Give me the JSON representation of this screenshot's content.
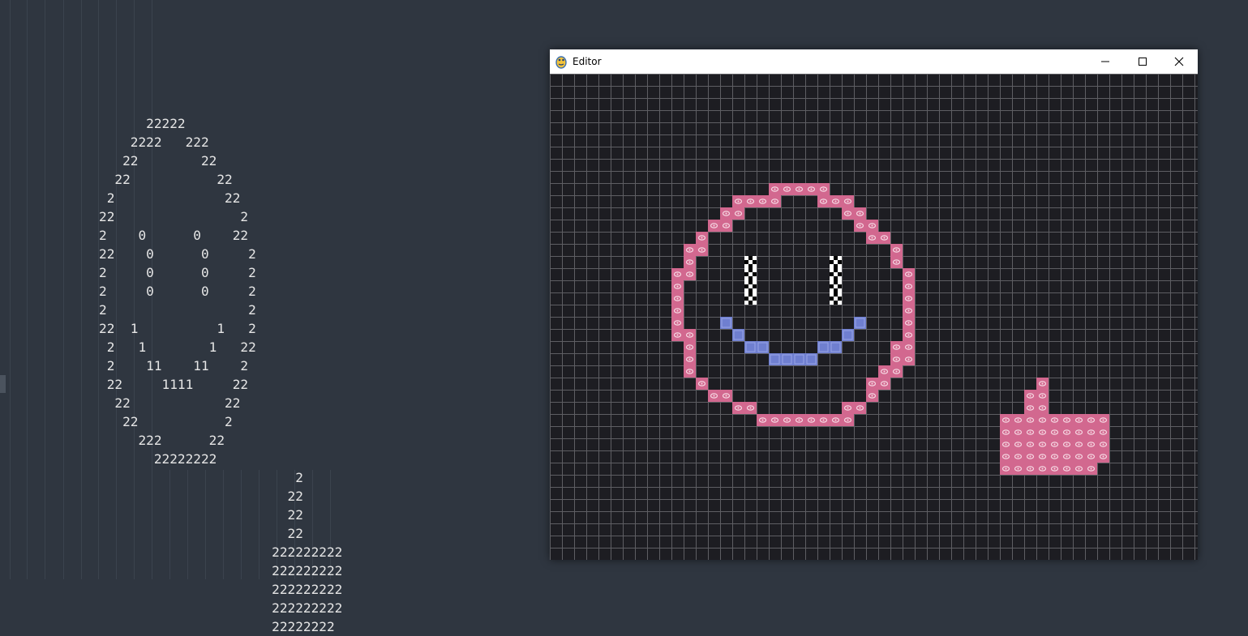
{
  "editor": {
    "lines": [
      "      22222",
      "    2222   222",
      "   22        22",
      "  22           22",
      " 2              22",
      "22                2",
      "2    0      0    22",
      "22    0      0     2",
      "2     0      0     2",
      "2     0      0     2",
      "2                  2",
      "22  1          1   2",
      " 2   1        1   22",
      " 2    11    11    2",
      " 22     1111     22",
      "  22            22",
      "   22           2",
      "     222      22",
      "       22222222",
      "                         2",
      "                        22",
      "                        22",
      "                        22",
      "                      222222222",
      "                      222222222",
      "                      222222222",
      "                      222222222",
      "                      22222222"
    ],
    "line_offsets_chars": [
      5,
      4,
      3,
      2,
      1,
      1,
      1,
      0,
      0,
      0,
      0,
      0,
      1,
      1,
      1,
      2,
      3,
      4,
      6,
      0,
      0,
      0,
      0,
      0,
      0,
      0,
      0,
      0
    ]
  },
  "window": {
    "title": "Editor",
    "icon": "pygame-snake-icon",
    "controls": [
      "minimize-icon",
      "maximize-icon",
      "close-icon"
    ]
  },
  "grid": {
    "cols": 53,
    "rows": 40,
    "background": "#1d1d22",
    "line_color": "#5e5e63",
    "tiles": {
      "2": {
        "name": "pink-chain-tile",
        "fill": "#d2688f",
        "detail": "#f6d8e3"
      },
      "1": {
        "name": "blue-tile",
        "fill": "#6f7fd0",
        "detail": "#9aa6e6"
      },
      "0": {
        "name": "checker-tile",
        "fill": "#000000",
        "detail": "#ffffff"
      }
    },
    "rows_data": [
      "",
      "",
      "",
      "",
      "",
      "",
      "",
      "",
      "",
      "                   ====",
      "               ====    ===",
      "              ==          ==",
      "             ==             ==",
      "            =                ==",
      "           ==                  =",
      "           =                   =",
      "          ==                    =",
      "          =     0      0        =",
      "          ==    0      0        =",
      "          ==    0      0        =",
      "          ==    0      0        =",
      "          ==                    =",
      "          ==                   ==",
      "          ==  1          1    ==",
      "           =   1        1     ==",
      "           =    11    11     ==",
      "           =      1111       ==",
      "            ==               =",
      "             ==            ==",
      "               ==        ==",
      "                 ========",
      "",
      "",
      "",
      "",
      "",
      "",
      "",
      "",
      ""
    ],
    "cells": [
      [
        9,
        18
      ],
      [
        9,
        19
      ],
      [
        9,
        20
      ],
      [
        9,
        21
      ],
      [
        9,
        22
      ],
      [
        10,
        15
      ],
      [
        10,
        16
      ],
      [
        10,
        17
      ],
      [
        10,
        18
      ],
      [
        10,
        22
      ],
      [
        10,
        23
      ],
      [
        10,
        24
      ],
      [
        11,
        14
      ],
      [
        11,
        15
      ],
      [
        11,
        24
      ],
      [
        11,
        25
      ],
      [
        12,
        13
      ],
      [
        12,
        14
      ],
      [
        12,
        25
      ],
      [
        12,
        26
      ],
      [
        13,
        12
      ],
      [
        13,
        26
      ],
      [
        13,
        27
      ],
      [
        14,
        11
      ],
      [
        14,
        12
      ],
      [
        14,
        28
      ],
      [
        15,
        11
      ],
      [
        15,
        28
      ],
      [
        16,
        10
      ],
      [
        16,
        11
      ],
      [
        16,
        29
      ],
      [
        17,
        10
      ],
      [
        17,
        29
      ],
      [
        18,
        10
      ],
      [
        18,
        29
      ],
      [
        19,
        10
      ],
      [
        19,
        29
      ],
      [
        20,
        10
      ],
      [
        20,
        29
      ],
      [
        21,
        10
      ],
      [
        21,
        11
      ],
      [
        21,
        29
      ],
      [
        22,
        11
      ],
      [
        22,
        28
      ],
      [
        22,
        29
      ],
      [
        23,
        11
      ],
      [
        23,
        28
      ],
      [
        23,
        29
      ],
      [
        24,
        11
      ],
      [
        24,
        27
      ],
      [
        24,
        28
      ],
      [
        25,
        12
      ],
      [
        25,
        26
      ],
      [
        25,
        27
      ],
      [
        26,
        13
      ],
      [
        26,
        14
      ],
      [
        26,
        26
      ],
      [
        27,
        15
      ],
      [
        27,
        16
      ],
      [
        27,
        24
      ],
      [
        27,
        25
      ],
      [
        28,
        17
      ],
      [
        28,
        18
      ],
      [
        28,
        19
      ],
      [
        28,
        20
      ],
      [
        28,
        21
      ],
      [
        28,
        22
      ],
      [
        28,
        23
      ],
      [
        28,
        24
      ],
      [
        25,
        40
      ],
      [
        26,
        39
      ],
      [
        26,
        40
      ],
      [
        27,
        39
      ],
      [
        27,
        40
      ],
      [
        28,
        37
      ],
      [
        28,
        38
      ],
      [
        28,
        39
      ],
      [
        28,
        40
      ],
      [
        28,
        41
      ],
      [
        28,
        42
      ],
      [
        28,
        43
      ],
      [
        28,
        44
      ],
      [
        28,
        45
      ],
      [
        29,
        37
      ],
      [
        29,
        38
      ],
      [
        29,
        39
      ],
      [
        29,
        40
      ],
      [
        29,
        41
      ],
      [
        29,
        42
      ],
      [
        29,
        43
      ],
      [
        29,
        44
      ],
      [
        29,
        45
      ],
      [
        30,
        37
      ],
      [
        30,
        38
      ],
      [
        30,
        39
      ],
      [
        30,
        40
      ],
      [
        30,
        41
      ],
      [
        30,
        42
      ],
      [
        30,
        43
      ],
      [
        30,
        44
      ],
      [
        30,
        45
      ],
      [
        31,
        37
      ],
      [
        31,
        38
      ],
      [
        31,
        39
      ],
      [
        31,
        40
      ],
      [
        31,
        41
      ],
      [
        31,
        42
      ],
      [
        31,
        43
      ],
      [
        31,
        44
      ],
      [
        31,
        45
      ],
      [
        32,
        37
      ],
      [
        32,
        38
      ],
      [
        32,
        39
      ],
      [
        32,
        40
      ],
      [
        32,
        41
      ],
      [
        32,
        42
      ],
      [
        32,
        43
      ],
      [
        32,
        44
      ]
    ],
    "eye_cells": [
      [
        15,
        16
      ],
      [
        16,
        16
      ],
      [
        17,
        16
      ],
      [
        18,
        16
      ],
      [
        15,
        23
      ],
      [
        16,
        23
      ],
      [
        17,
        23
      ],
      [
        18,
        23
      ]
    ],
    "mouth_cells": [
      [
        20,
        14
      ],
      [
        21,
        15
      ],
      [
        22,
        16
      ],
      [
        22,
        17
      ],
      [
        23,
        18
      ],
      [
        23,
        19
      ],
      [
        23,
        20
      ],
      [
        23,
        21
      ],
      [
        22,
        22
      ],
      [
        22,
        23
      ],
      [
        21,
        24
      ],
      [
        20,
        25
      ]
    ]
  }
}
